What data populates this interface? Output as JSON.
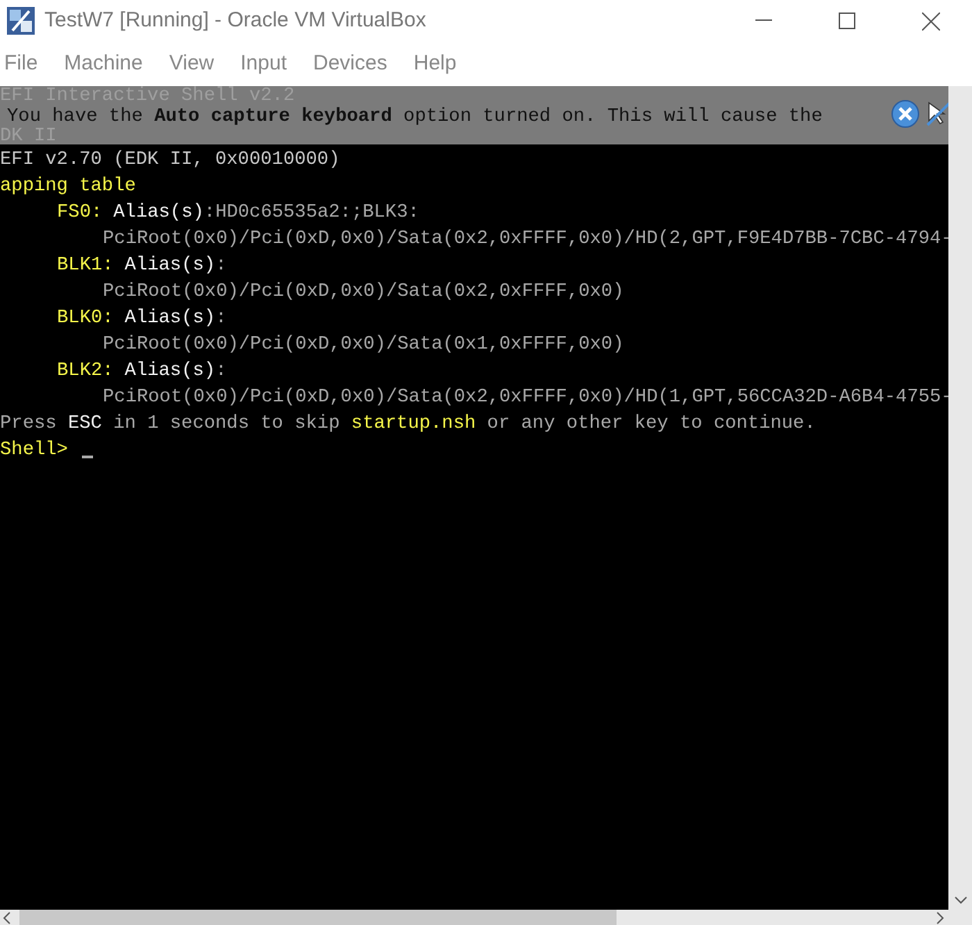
{
  "window": {
    "title": "TestW7 [Running] - Oracle VM VirtualBox"
  },
  "menu": [
    "File",
    "Machine",
    "View",
    "Input",
    "Devices",
    "Help"
  ],
  "notification": {
    "message": "You have the **Auto capture keyboard** option turned on. This will cause the"
  },
  "console": {
    "header": [
      "EFI Interactive Shell v2.2",
      "DK II",
      "EFI v2.70 (EDK II, 0x00010000)"
    ],
    "mapping_title": "apping table",
    "mappings": [
      {
        "name": "FS0:",
        "alias_label": "Alias(s)",
        "aliases": ":HD0c65535a2:;BLK3:",
        "path": "PciRoot(0x0)/Pci(0xD,0x0)/Sata(0x2,0xFFFF,0x0)/HD(2,GPT,F9E4D7BB-7CBC-4794-"
      },
      {
        "name": "BLK1:",
        "alias_label": "Alias(s)",
        "aliases": ":",
        "path": "PciRoot(0x0)/Pci(0xD,0x0)/Sata(0x2,0xFFFF,0x0)"
      },
      {
        "name": "BLK0:",
        "alias_label": "Alias(s)",
        "aliases": ":",
        "path": "PciRoot(0x0)/Pci(0xD,0x0)/Sata(0x1,0xFFFF,0x0)"
      },
      {
        "name": "BLK2:",
        "alias_label": "Alias(s)",
        "aliases": ":",
        "path": "PciRoot(0x0)/Pci(0xD,0x0)/Sata(0x2,0xFFFF,0x0)/HD(1,GPT,56CCA32D-A6B4-4755-"
      }
    ],
    "startup_line": [
      {
        "text": "Press ",
        "kind": "normal"
      },
      {
        "text": "ESC",
        "kind": "bright"
      },
      {
        "text": " in 1 seconds to skip ",
        "kind": "normal"
      },
      {
        "text": "startup.nsh",
        "kind": "highlight"
      },
      {
        "text": " or any other key to continue.",
        "kind": "normal"
      }
    ],
    "prompt": "Shell>"
  }
}
